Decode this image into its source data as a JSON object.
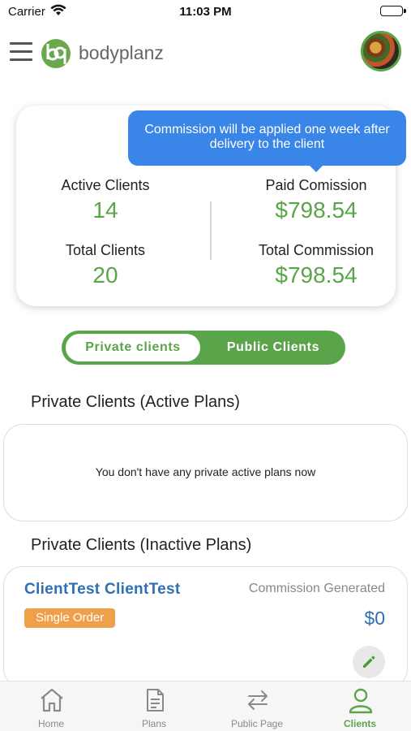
{
  "status_bar": {
    "carrier": "Carrier",
    "time": "11:03 PM"
  },
  "header": {
    "brand": "bodyplanz"
  },
  "tooltip": {
    "text": "Commission will be applied one week after delivery to the client"
  },
  "stats": {
    "active_clients": {
      "label": "Active Clients",
      "value": "14"
    },
    "total_clients": {
      "label": "Total Clients",
      "value": "20"
    },
    "paid_commission": {
      "label": "Paid Comission",
      "value": "$798.54"
    },
    "total_commission": {
      "label": "Total Commission",
      "value": "$798.54"
    }
  },
  "segment": {
    "private_label": "Private clients",
    "public_label": "Public Clients"
  },
  "sections": {
    "active_title": "Private Clients (Active Plans)",
    "active_empty": "You don't have any private active plans now",
    "inactive_title": "Private Clients (Inactive Plans)"
  },
  "client": {
    "name": "ClientTest ClientTest",
    "commission_label": "Commission Generated",
    "commission_value": "$0",
    "badge": "Single Order"
  },
  "tabs": [
    {
      "label": "Home",
      "icon": "home-icon"
    },
    {
      "label": "Plans",
      "icon": "document-icon"
    },
    {
      "label": "Public Page",
      "icon": "swap-arrows-icon"
    },
    {
      "label": "Clients",
      "icon": "person-icon"
    }
  ],
  "colors": {
    "brand_green": "#5aa44a",
    "link_blue": "#2f6fb3",
    "tooltip_blue": "#3a86e8",
    "badge_orange": "#f0a04b"
  }
}
